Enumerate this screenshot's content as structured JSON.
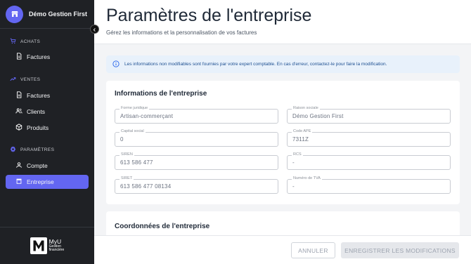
{
  "app": {
    "org_name": "Démo Gestion First",
    "logo_brand": "MyU",
    "logo_sub_1": "Gestion",
    "logo_sub_2": "financière"
  },
  "sidebar": {
    "sections": [
      {
        "label": "ACHATS",
        "icon": "cart-icon"
      },
      {
        "label": "VENTES",
        "icon": "trend-up-icon"
      },
      {
        "label": "PARAMÈTRES",
        "icon": "settings-icon"
      }
    ],
    "items": [
      {
        "label": "Factures",
        "icon": "invoice-icon"
      },
      {
        "label": "Factures",
        "icon": "invoice-icon"
      },
      {
        "label": "Clients",
        "icon": "users-icon"
      },
      {
        "label": "Produits",
        "icon": "box-icon"
      },
      {
        "label": "Compte",
        "icon": "person-icon"
      },
      {
        "label": "Entreprise",
        "icon": "store-icon",
        "active": true
      }
    ],
    "accent_color": "#6366f1"
  },
  "header": {
    "title": "Paramètres de l'entreprise",
    "subtitle": "Gérez les informations et la personnalisation de vos factures"
  },
  "info_banner": {
    "text": "Les informations non modifiables sont fournies par votre expert comptable. En cas d'erreur, contactez-le pour faire la modification.",
    "icon": "info-icon"
  },
  "company_info": {
    "title": "Informations de l'entreprise",
    "fields": [
      {
        "label": "Forme juridique",
        "value": "Artisan-commerçant"
      },
      {
        "label": "Raison sociale",
        "value": "Démo Gestion First"
      },
      {
        "label": "Capital social",
        "value": "0"
      },
      {
        "label": "Code APE",
        "value": "7311Z"
      },
      {
        "label": "SIREN",
        "value": "613 586 477"
      },
      {
        "label": "RCS",
        "value": "-"
      },
      {
        "label": "SIRET",
        "value": "613 586 477 08134"
      },
      {
        "label": "Numéro de TVA",
        "value": "-"
      }
    ]
  },
  "contact_info": {
    "title": "Coordonnées de l'entreprise"
  },
  "footer": {
    "cancel_label": "ANNULER",
    "save_label": "ENREGISTRER LES MODIFICATIONS"
  }
}
